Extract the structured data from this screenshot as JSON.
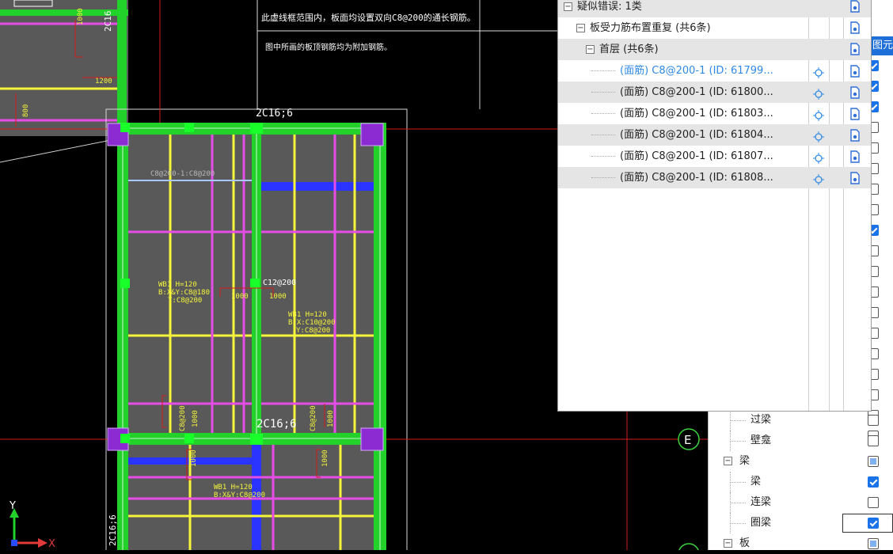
{
  "drawing": {
    "note_line1": "此虚线框范围内，板面均设置双向C8@200的通长钢筋。",
    "note_line2": "图中所画的板顶钢筋均为附加钢筋。",
    "beam_top": "2C16;6",
    "beam_mid": "2C16;6",
    "beam_left": "2C16;6",
    "beam_left_top": "2C16",
    "slab_left": "WB1 H=120",
    "slab_left_2": "B:X&Y:C8@180",
    "slab_left_3": "T:C8@200",
    "slab_right": "WB1 H=120",
    "slab_right_2": "B:X:C10@200",
    "slab_right_3": "Y:C8@200",
    "slab_bottom": "WB1 H=120",
    "slab_bottom_2": "B:X&Y:C8@200",
    "rebar_mid": "C12@200",
    "rebar_top": "C8@200-1:C8@200",
    "dim_1000": "1000",
    "dim_1200": "1200",
    "dim_800": "800",
    "rebar_c8": "C8@200",
    "axis_e": "E",
    "axis_y": "Y",
    "axis_x": "X"
  },
  "error_panel": {
    "root": "疑似错误: 1类",
    "group": "板受力筋布置重复 (共6条)",
    "floor": "首层 (共6条)",
    "items": [
      "(面筋) C8@200-1 (ID: 61799...",
      "(面筋) C8@200-1 (ID: 61800...",
      "(面筋) C8@200-1 (ID: 61803...",
      "(面筋) C8@200-1 (ID: 61804...",
      "(面筋) C8@200-1 (ID: 61807...",
      "(面筋) C8@200-1 (ID: 61808..."
    ]
  },
  "layer_panel": {
    "tab_label": "图元",
    "rows": [
      {
        "label": "过梁",
        "check": "off"
      },
      {
        "label": "壁龛",
        "check": "off"
      },
      {
        "label": "梁",
        "check": "partial",
        "group": true
      },
      {
        "label": "梁",
        "check": "on"
      },
      {
        "label": "连梁",
        "check": "off"
      },
      {
        "label": "圈梁",
        "check": "on"
      },
      {
        "label": "板",
        "check": "partial",
        "group": true
      }
    ],
    "upper_checks": [
      "on",
      "on",
      "on",
      "off",
      "off",
      "off",
      "off",
      "off",
      "on",
      "off",
      "off",
      "off",
      "off",
      "off",
      "off",
      "off",
      "off",
      "off",
      "off"
    ]
  },
  "colors": {
    "beam": "#22d12a",
    "rebar_y": "#f5f53a",
    "rebar_m": "#e64de6",
    "slab": "#595959",
    "axis_line": "#d41a1a",
    "selection": "#2f8ae6"
  }
}
